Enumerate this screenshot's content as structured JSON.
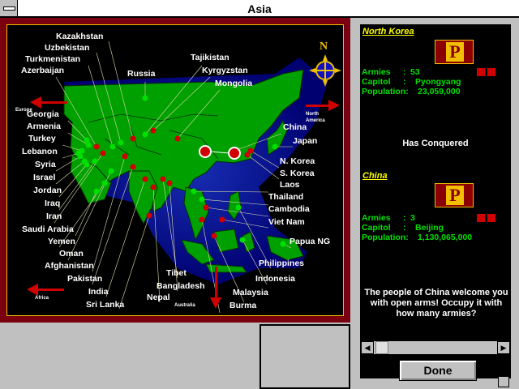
{
  "window": {
    "title": "Asia"
  },
  "map": {
    "countries": [
      "Kazakhstan",
      "Uzbekistan",
      "Turkmenistan",
      "Azerbaijan",
      "Georgia",
      "Armenia",
      "Turkey",
      "Lebanon",
      "Syria",
      "Israel",
      "Jordan",
      "Iraq",
      "Iran",
      "Saudi Arabia",
      "Yemen",
      "Oman",
      "Afghanistan",
      "Pakistan",
      "India",
      "Sri Lanka",
      "Nepal",
      "Bangladesh",
      "Tibet",
      "Burma",
      "Malaysia",
      "Indonesia",
      "Philippines",
      "Papua NG",
      "Viet Nam",
      "Cambodia",
      "Thailand",
      "Laos",
      "S. Korea",
      "N. Korea",
      "Japan",
      "China",
      "Mongolia",
      "Kyrgyzstan",
      "Tajikistan",
      "Russia"
    ],
    "arrows": {
      "europe": "Europe",
      "north_america": "North America",
      "africa": "Africa",
      "australia": "Australia"
    },
    "compass_letter": "N"
  },
  "panel": {
    "attacker": {
      "name": "North Korea",
      "flag_letter": "P",
      "armies_label": "Armies",
      "armies": "53",
      "capitol_label": "Capitol",
      "capitol": "Pyongyang",
      "population_label": "Population:",
      "population": "23,059,000"
    },
    "conquered_text": "Has Conquered",
    "defender": {
      "name": "China",
      "flag_letter": "P",
      "armies_label": "Armies",
      "armies": "3",
      "capitol_label": "Capitol",
      "capitol": "Beijing",
      "population_label": "Population:",
      "population": "1,130,065,000"
    },
    "message": "The people of China welcome you with open arms!  Occupy it with how many armies?",
    "done_label": "Done"
  },
  "colors": {
    "land": "#00a000",
    "water": "#0000c0",
    "frame": "#7a0010",
    "label": "#ffffff",
    "stats": "#00e000",
    "nation_name": "#ffff00"
  }
}
